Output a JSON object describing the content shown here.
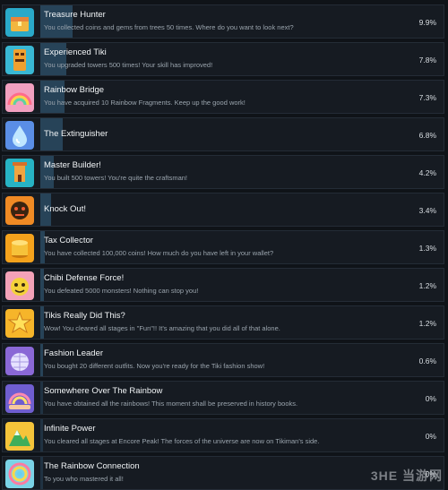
{
  "achievements": [
    {
      "title": "Treasure Hunter",
      "desc": "You collected coins and gems from trees 50 times. Where do you want to look next?",
      "percent": "9.9%",
      "progress": 0.082,
      "icon": "treasure-chest-icon",
      "color": "#2aa9c9"
    },
    {
      "title": "Experienced Tiki",
      "desc": "You upgraded towers 500 times! Your skill has improved!",
      "percent": "7.8%",
      "progress": 0.065,
      "icon": "tiki-totem-icon",
      "color": "#39b8d4"
    },
    {
      "title": "Rainbow Bridge",
      "desc": "You have acquired 10 Rainbow Fragments. Keep up the good work!",
      "percent": "7.3%",
      "progress": 0.061,
      "icon": "rainbow-icon",
      "color": "#f2a0c0"
    },
    {
      "title": "The Extinguisher",
      "desc": "",
      "percent": "6.8%",
      "progress": 0.057,
      "icon": "water-drop-icon",
      "color": "#5a8ee6"
    },
    {
      "title": "Master Builder!",
      "desc": "You built 500 towers! You're quite the craftsman!",
      "percent": "4.2%",
      "progress": 0.035,
      "icon": "tower-icon",
      "color": "#27b3c4"
    },
    {
      "title": "Knock Out!",
      "desc": "",
      "percent": "3.4%",
      "progress": 0.028,
      "icon": "knockout-icon",
      "color": "#f08a24"
    },
    {
      "title": "Tax Collector",
      "desc": "You have collected 100,000 coins! How much do you have left in your wallet?",
      "percent": "1.3%",
      "progress": 0.011,
      "icon": "coin-stack-icon",
      "color": "#f4a21c"
    },
    {
      "title": "Chibi Defense Force!",
      "desc": "You defeated 5000 monsters! Nothing can stop you!",
      "percent": "1.2%",
      "progress": 0.01,
      "icon": "monster-icon",
      "color": "#f3a2b8"
    },
    {
      "title": "Tikis Really Did This?",
      "desc": "Wow! You cleared all stages in \"Fun\"!! It's amazing that you did all of that alone.",
      "percent": "1.2%",
      "progress": 0.01,
      "icon": "star-icon",
      "color": "#f6b52a"
    },
    {
      "title": "Fashion Leader",
      "desc": "You bought 20 different outfits. Now you're ready for the Tiki fashion show!",
      "percent": "0.6%",
      "progress": 0.005,
      "icon": "disco-ball-icon",
      "color": "#8a68d6"
    },
    {
      "title": "Somewhere Over The Rainbow",
      "desc": "You have obtained all the rainbows! This moment shall be preserved in history books.",
      "percent": "0%",
      "progress": 0,
      "icon": "rainbow-hands-icon",
      "color": "#6f5ed0"
    },
    {
      "title": "Infinite Power",
      "desc": "You cleared all stages at Encore Peak! The forces of the universe are now on Tikiman's side.",
      "percent": "0%",
      "progress": 0,
      "icon": "mountain-icon",
      "color": "#f5c43a"
    },
    {
      "title": "The Rainbow Connection",
      "desc": "To you who mastered it all!",
      "percent": "0%",
      "progress": 0,
      "icon": "rainbow-circle-icon",
      "color": "#7bd3e6"
    }
  ],
  "watermark": "3HE 当游网"
}
